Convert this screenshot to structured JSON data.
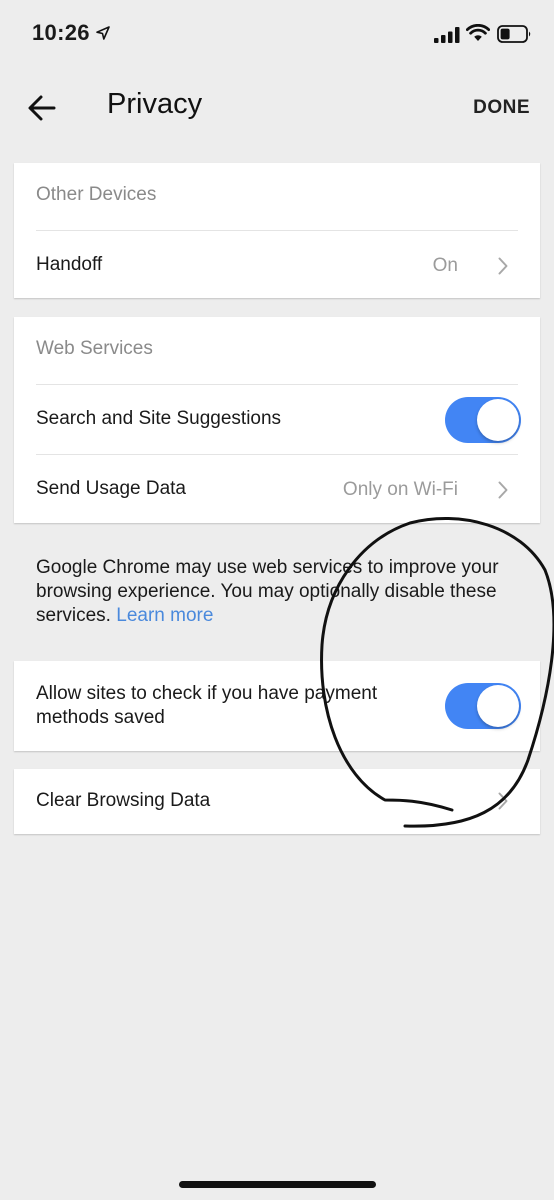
{
  "status_bar": {
    "time": "10:26",
    "icons": [
      "location-arrow-icon",
      "cellular-signal-icon",
      "wifi-icon",
      "battery-icon"
    ]
  },
  "header": {
    "title": "Privacy",
    "done_label": "DONE",
    "back_icon": "back-arrow-icon"
  },
  "other_devices": {
    "section_title": "Other Devices",
    "handoff": {
      "label": "Handoff",
      "value": "On"
    }
  },
  "web_services": {
    "section_title": "Web Services",
    "search_suggestions": {
      "label": "Search and Site Suggestions",
      "enabled": true
    },
    "usage_data": {
      "label": "Send Usage Data",
      "value": "Only on Wi-Fi"
    }
  },
  "info": {
    "text": "Google Chrome may use web services to improve your browsing experience. You may optionally disable these services. ",
    "link": "Learn more"
  },
  "payment_methods": {
    "label": "Allow sites to check if you have payment methods saved",
    "enabled": true
  },
  "clear_browsing": {
    "label": "Clear Browsing Data"
  },
  "colors": {
    "background": "#ededed",
    "toggle_on": "#4285f4",
    "link": "#4a89dc",
    "secondary_text": "#9b9b9b"
  }
}
